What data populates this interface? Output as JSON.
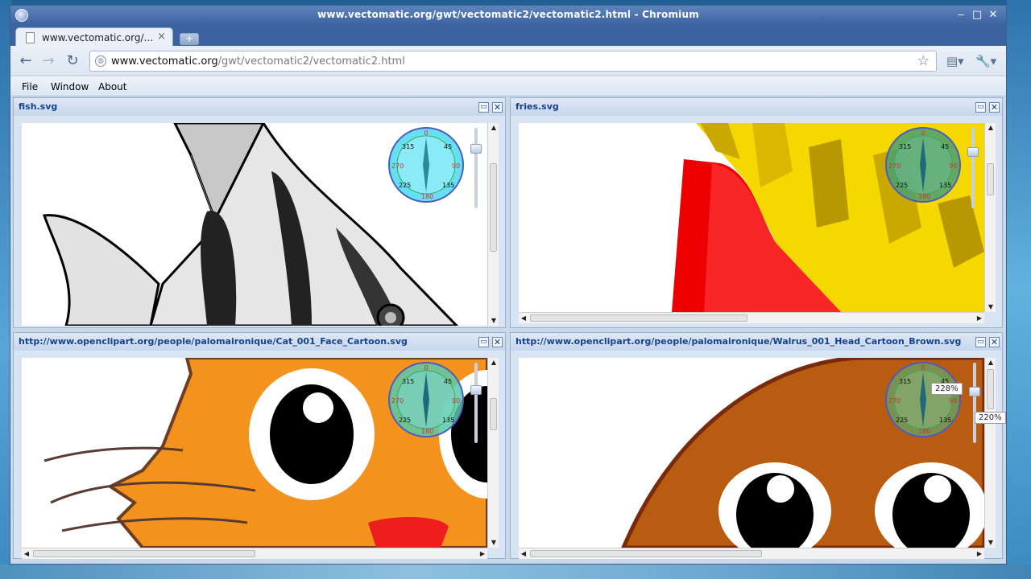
{
  "window": {
    "title": "www.vectomatic.org/gwt/vectomatic2/vectomatic2.html - Chromium"
  },
  "tab": {
    "label": "www.vectomatic.org/...",
    "close": "×"
  },
  "newtab": {
    "label": "+"
  },
  "address": {
    "host": "www.vectomatic.org",
    "path": "/gwt/vectomatic2/vectomatic2.html"
  },
  "menu": {
    "file": "File",
    "window": "Window",
    "about": "About"
  },
  "windows": [
    {
      "title": "fish.svg"
    },
    {
      "title": "fries.svg"
    },
    {
      "title": "http://www.openclipart.org/people/palomaironique/Cat_001_Face_Cartoon.svg"
    },
    {
      "title": "http://www.openclipart.org/people/palomaironique/Walrus_001_Head_Cartoon_Brown.svg"
    }
  ],
  "compass": {
    "n": "0",
    "ne": "45",
    "e": "90",
    "se": "135",
    "s": "180",
    "sw": "225",
    "w": "270",
    "nw": "315"
  },
  "zoom": {
    "tooltip1": "228%",
    "tooltip2": "220%"
  }
}
